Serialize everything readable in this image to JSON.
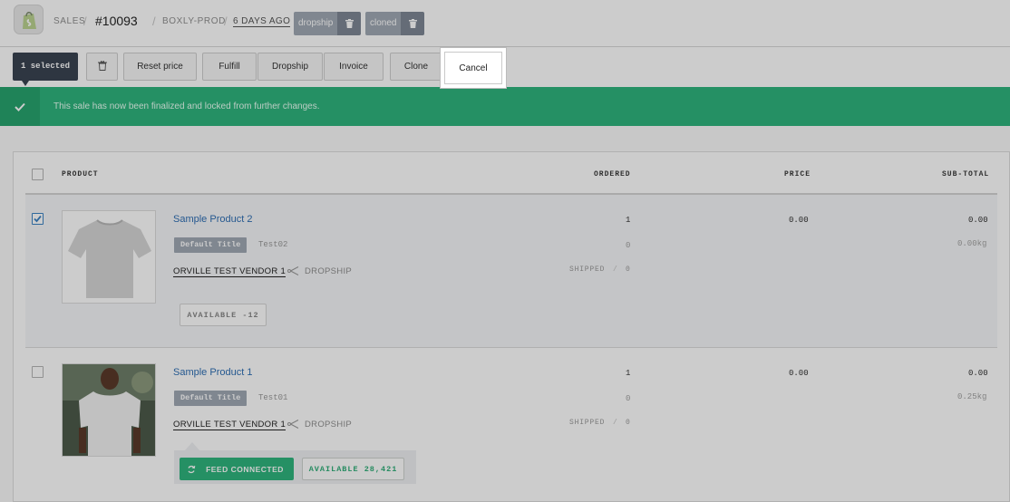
{
  "header": {
    "breadcrumb_sales": "SALES",
    "order_number": "#10093",
    "store": "BOXLY-PROD",
    "time_ago": "6 DAYS AGO",
    "tags": [
      "dropship",
      "cloned"
    ]
  },
  "toolbar": {
    "selected_label": "1 selected",
    "buttons": {
      "reset_price": "Reset price",
      "fulfill": "Fulfill",
      "dropship": "Dropship",
      "invoice": "Invoice",
      "clone": "Clone",
      "cancel": "Cancel"
    }
  },
  "banner": {
    "message": "This sale has now been finalized and locked from further changes."
  },
  "table": {
    "columns": {
      "product": "PRODUCT",
      "ordered": "ORDERED",
      "price": "PRICE",
      "subtotal": "SUB-TOTAL"
    },
    "rows": [
      {
        "checked": true,
        "name": "Sample Product 2",
        "variant": "Default Title",
        "sku": "Test02",
        "vendor": "ORVILLE TEST VENDOR 1",
        "fulfillment": "DROPSHIP",
        "ordered": "1",
        "ordered_sub": "0",
        "shipped_label": "SHIPPED",
        "shipped": "0",
        "price": "0.00",
        "subtotal": "0.00",
        "weight": "0.00kg",
        "available": "AVAILABLE -12"
      },
      {
        "checked": false,
        "name": "Sample Product 1",
        "variant": "Default Title",
        "sku": "Test01",
        "vendor": "ORVILLE TEST VENDOR 1",
        "fulfillment": "DROPSHIP",
        "ordered": "1",
        "ordered_sub": "0",
        "shipped_label": "SHIPPED",
        "shipped": "0",
        "price": "0.00",
        "subtotal": "0.00",
        "weight": "0.25kg",
        "feed_status": "FEED CONNECTED",
        "available": "AVAILABLE 28,421"
      }
    ]
  },
  "colors": {
    "success": "#2fb57d",
    "link": "#2f6fb4",
    "tag": "#a0a9b5",
    "dark": "#3a4452"
  }
}
